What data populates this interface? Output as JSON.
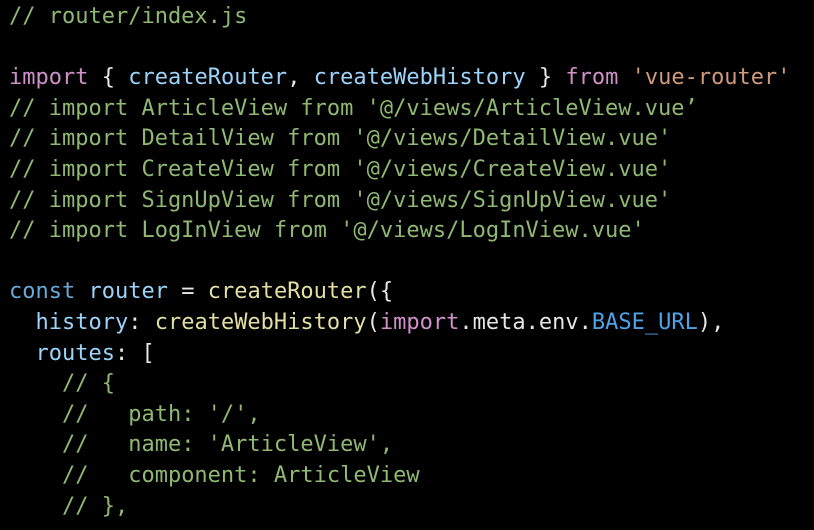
{
  "colors": {
    "background": "#000000",
    "comment": "#8fb873",
    "keyword": "#cf8fc9",
    "storage": "#6aa8d8",
    "function": "#e2dfa4",
    "string": "#d19a7a",
    "property": "#9cd3fa",
    "constant": "#4ea3e6",
    "punctuation": "#e6e6e6"
  },
  "code": {
    "lines": [
      [
        [
          "comment",
          "// router/index.js"
        ]
      ],
      [],
      [
        [
          "keyword",
          "import"
        ],
        [
          "punct",
          " { "
        ],
        [
          "var",
          "createRouter"
        ],
        [
          "punct",
          ", "
        ],
        [
          "var",
          "createWebHistory"
        ],
        [
          "punct",
          " } "
        ],
        [
          "keyword",
          "from"
        ],
        [
          "punct",
          " "
        ],
        [
          "string",
          "'vue-router'"
        ]
      ],
      [
        [
          "comment",
          "// import ArticleView from '@/views/ArticleView.vue’"
        ]
      ],
      [
        [
          "comment",
          "// import DetailView from '@/views/DetailView.vue'"
        ]
      ],
      [
        [
          "comment",
          "// import CreateView from '@/views/CreateView.vue'"
        ]
      ],
      [
        [
          "comment",
          "// import SignUpView from '@/views/SignUpView.vue'"
        ]
      ],
      [
        [
          "comment",
          "// import LogInView from '@/views/LogInView.vue'"
        ]
      ],
      [],
      [
        [
          "storage",
          "const"
        ],
        [
          "punct",
          " "
        ],
        [
          "var",
          "router"
        ],
        [
          "punct",
          " = "
        ],
        [
          "func",
          "createRouter"
        ],
        [
          "punct",
          "({"
        ]
      ],
      [
        [
          "punct",
          "  "
        ],
        [
          "prop",
          "history"
        ],
        [
          "punct",
          ": "
        ],
        [
          "func",
          "createWebHistory"
        ],
        [
          "punct",
          "("
        ],
        [
          "keyword",
          "import"
        ],
        [
          "punct",
          "."
        ],
        [
          "ident",
          "meta"
        ],
        [
          "punct",
          "."
        ],
        [
          "ident",
          "env"
        ],
        [
          "punct",
          "."
        ],
        [
          "const",
          "BASE_URL"
        ],
        [
          "punct",
          "),"
        ]
      ],
      [
        [
          "punct",
          "  "
        ],
        [
          "prop",
          "routes"
        ],
        [
          "punct",
          ": ["
        ]
      ],
      [
        [
          "punct",
          "    "
        ],
        [
          "comment",
          "// {"
        ]
      ],
      [
        [
          "punct",
          "    "
        ],
        [
          "comment",
          "//   path: '/',"
        ]
      ],
      [
        [
          "punct",
          "    "
        ],
        [
          "comment",
          "//   name: 'ArticleView',"
        ]
      ],
      [
        [
          "punct",
          "    "
        ],
        [
          "comment",
          "//   component: ArticleView"
        ]
      ],
      [
        [
          "punct",
          "    "
        ],
        [
          "comment",
          "// },"
        ]
      ]
    ]
  }
}
